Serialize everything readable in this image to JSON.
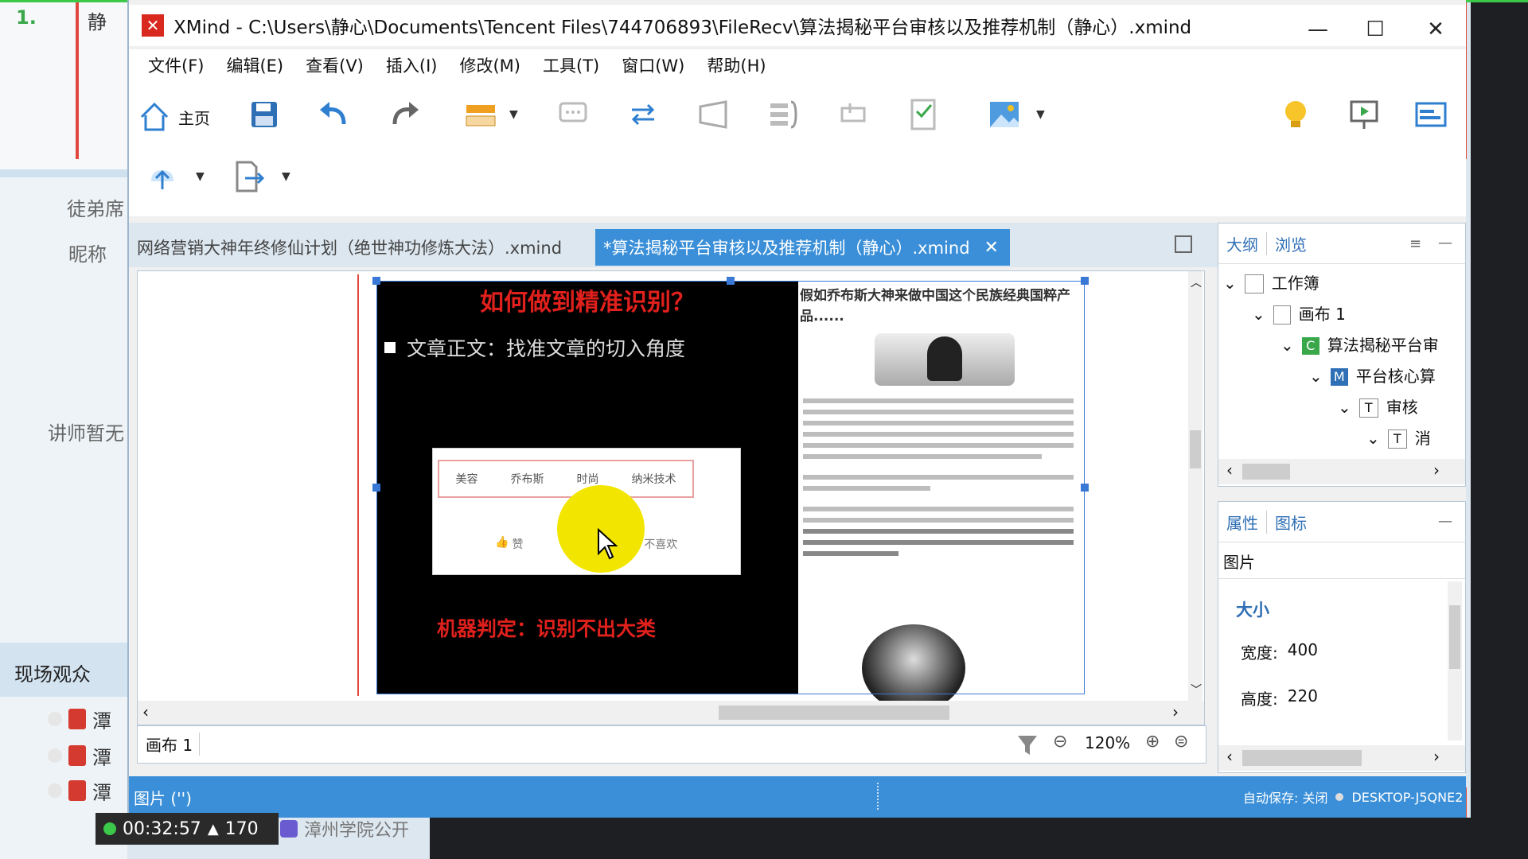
{
  "left_app": {
    "rank": "1.",
    "top_label": "静",
    "label1": "徒弟席",
    "label2": "昵称",
    "label3": "讲师暂无",
    "live_label": "现场观众",
    "row_prefix": "潭",
    "footer_text": "漳州学院公开",
    "timer": "00:32:57",
    "viewers": "170"
  },
  "window": {
    "title": "XMind - C:\\Users\\静心\\Documents\\Tencent Files\\744706893\\FileRecv\\算法揭秘平台审核以及推荐机制（静心）.xmind",
    "minimize": "—",
    "maximize": "☐",
    "close": "✕"
  },
  "menu": [
    "文件(F)",
    "编辑(E)",
    "查看(V)",
    "插入(I)",
    "修改(M)",
    "工具(T)",
    "窗口(W)",
    "帮助(H)"
  ],
  "toolbar": {
    "home_label": "主页",
    "icons": [
      "home-icon",
      "save-icon",
      "undo-icon",
      "redo-icon",
      "topic-icon",
      "callout-icon",
      "relationship-icon",
      "boundary-icon",
      "summary-icon",
      "marker-icon",
      "task-icon",
      "image-icon",
      "lightbulb-icon",
      "presentation-icon",
      "layout-icon",
      "share-icon",
      "export-icon"
    ]
  },
  "tabs": [
    {
      "label": "网络营销大神年终修仙计划（绝世神功修炼大法）.xmind",
      "active": false
    },
    {
      "label": "*算法揭秘平台审核以及推荐机制（静心）.xmind",
      "active": true
    }
  ],
  "slide": {
    "heading": "如何做到精准识别？",
    "bullet": "文章正文：找准文章的切入角度",
    "tags": [
      "美容",
      "乔布斯",
      "时尚",
      "纳米技术"
    ],
    "like_label": "赞",
    "dislike_label": "不喜欢",
    "verdict": "机器判定：识别不出大类",
    "article_title": "假如乔布斯大神来做中国这个民族经典国粹产品......"
  },
  "outline_panel": {
    "tabs": [
      "大纲",
      "浏览"
    ],
    "items": [
      {
        "label": "工作簿",
        "badge": ""
      },
      {
        "label": "画布 1",
        "badge": ""
      },
      {
        "label": "算法揭秘平台审",
        "badge": "C"
      },
      {
        "label": "平台核心算",
        "badge": "M"
      },
      {
        "label": "审核",
        "badge": "T"
      },
      {
        "label": "消",
        "badge": "T"
      }
    ]
  },
  "properties_panel": {
    "tabs": [
      "属性",
      "图标"
    ],
    "section": "图片",
    "group": "大小",
    "width_label": "宽度:",
    "width_value": "400",
    "height_label": "高度:",
    "height_value": "220"
  },
  "canvas_bar": {
    "sheet": "画布 1",
    "zoom": "120%"
  },
  "status": {
    "left": "图片 ('')",
    "autosave": "自动保存: 关闭",
    "machine": "DESKTOP-J5QNE2"
  },
  "colors": {
    "accent": "#3a8fd8",
    "slide_red": "#e0201c",
    "cursor_highlight": "#f2e600"
  }
}
